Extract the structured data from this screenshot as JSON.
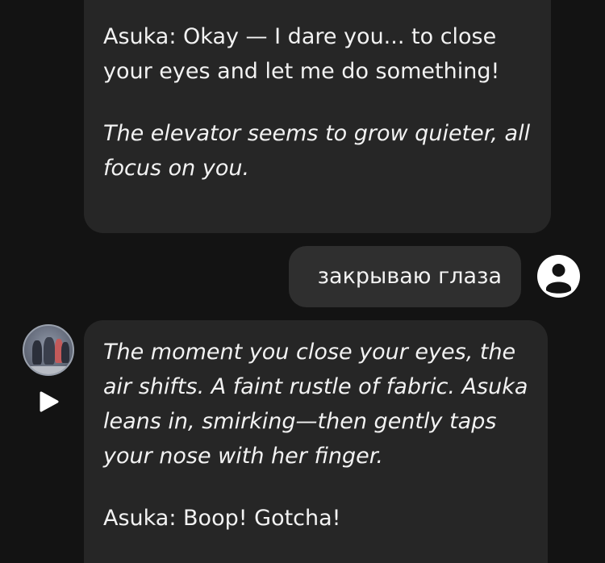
{
  "messages": {
    "top": {
      "line1": "Asuka: Okay — I dare you... to close your eyes and let me do something!",
      "line2": "The elevator seems to grow quieter, all focus on you."
    },
    "user": {
      "text": "закрываю глаза"
    },
    "bot": {
      "line1": "The moment you close your eyes, the air shifts. A faint rustle of fabric. Asuka leans in, smirking—then gently taps your nose with her finger.",
      "line2": "Asuka: Boop! Gotcha!"
    }
  },
  "icons": {
    "user_avatar": "user-circle-icon",
    "play": "play-icon"
  },
  "colors": {
    "background": "#131313",
    "bubble": "#262626",
    "user_bubble": "#2f2f2f",
    "text": "#f2f2f2"
  }
}
